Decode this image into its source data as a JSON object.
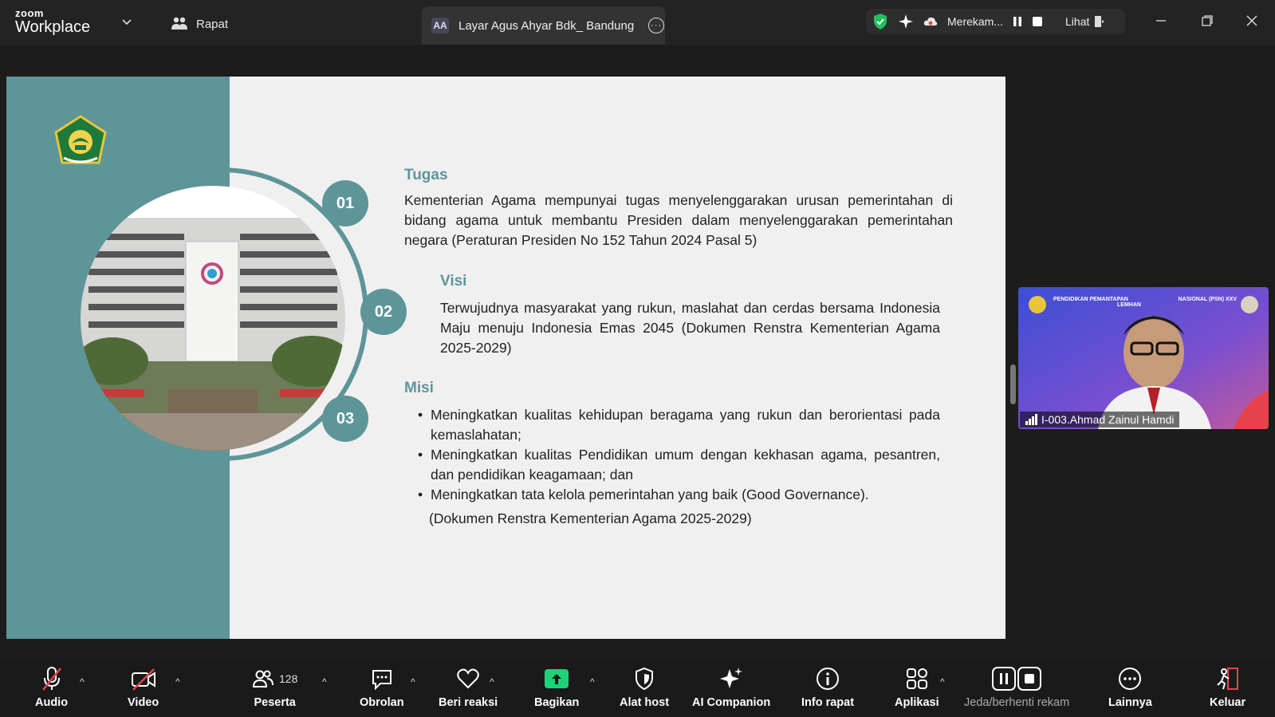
{
  "app": {
    "brand_top": "zoom",
    "brand_bottom": "Workplace"
  },
  "meeting": {
    "label": "Rapat"
  },
  "share_tab": {
    "badge": "AA",
    "title": "Layar Agus Ahyar Bdk_ Bandung"
  },
  "status": {
    "recording": "Merekam...",
    "view_label": "Lihat"
  },
  "slide": {
    "numbers": [
      "01",
      "02",
      "03"
    ],
    "tugas": {
      "heading": "Tugas",
      "text": "Kementerian Agama mempunyai tugas menyelenggarakan urusan pemerintahan di bidang agama untuk membantu Presiden dalam menyelenggarakan pemerintahan negara (Peraturan Presiden No 152 Tahun 2024 Pasal 5)"
    },
    "visi": {
      "heading": "Visi",
      "text": "Terwujudnya masyarakat yang rukun, maslahat dan cerdas bersama Indonesia Maju menuju Indonesia Emas 2045 (Dokumen Renstra Kementerian Agama 2025-2029)"
    },
    "misi": {
      "heading": "Misi",
      "items": [
        "Meningkatkan kualitas kehidupan beragama yang rukun dan berorientasi pada kemaslahatan;",
        "Meningkatkan kualitas Pendidikan umum dengan kekhasan agama, pesantren, dan pendidikan keagamaan; dan",
        "Meningkatkan tata kelola pemerintahan yang baik (Good Governance)."
      ],
      "note": "(Dokumen Renstra Kementerian Agama 2025-2029)"
    }
  },
  "video_tile": {
    "name": "I-003.Ahmad Zainul Hamdi",
    "banner_left": "PENDIDIKAN PEMANTAPAN",
    "banner_left2": "LEMHAN",
    "banner_right": "NASIONAL (PSN) XXV"
  },
  "toolbar": {
    "audio": "Audio",
    "video": "Video",
    "participants": "Peserta",
    "participants_count": "128",
    "chat": "Obrolan",
    "react": "Beri reaksi",
    "share": "Bagikan",
    "host_tools": "Alat host",
    "ai": "AI Companion",
    "info": "Info rapat",
    "apps": "Aplikasi",
    "record": "Jeda/berhenti rekam",
    "more": "Lainnya",
    "leave": "Keluar"
  },
  "colors": {
    "teal": "#5e9598",
    "share_green": "#1fd177",
    "leave_red": "#e5424d"
  }
}
